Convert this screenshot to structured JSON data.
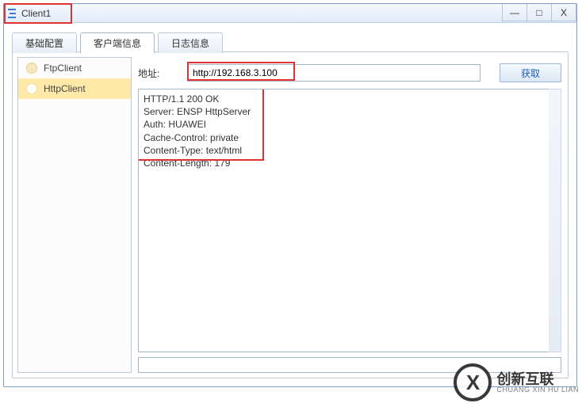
{
  "window": {
    "title": "Client1"
  },
  "tabs": {
    "basic": "基础配置",
    "client_info": "客户端信息",
    "log_info": "日志信息"
  },
  "sidebar": {
    "ftp": "FtpClient",
    "http": "HttpClient"
  },
  "address": {
    "label": "地址:",
    "value": "http://192.168.3.100",
    "fetch": "获取"
  },
  "response": {
    "line1": "HTTP/1.1 200 OK",
    "line2": "Server: ENSP HttpServer",
    "line3": "Auth: HUAWEI",
    "line4": "Cache-Control: private",
    "line5": "Content-Type: text/html",
    "line6": "Content-Length: 179"
  },
  "watermark": {
    "brand": "创新互联",
    "sub": "CHUANG XIN HU LIAN"
  },
  "colors": {
    "highlight": "#d33",
    "accent": "#1e5fb3"
  }
}
